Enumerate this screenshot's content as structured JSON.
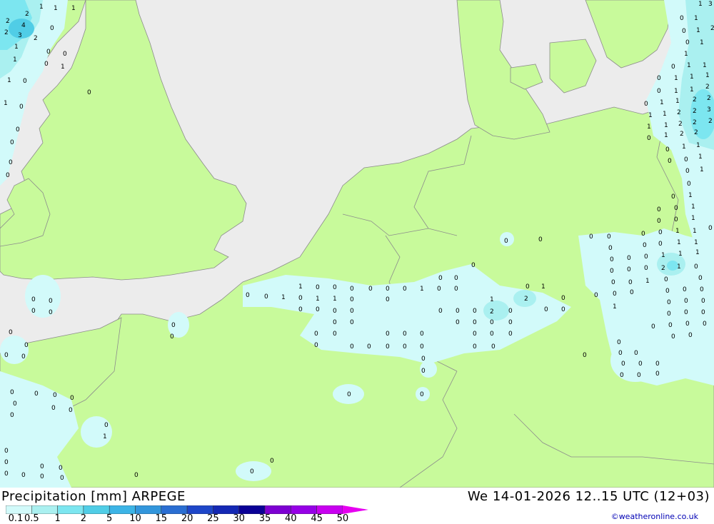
{
  "title": "Precipitation [mm] ARPEGE",
  "datetime": "We 14-01-2026 12..15 UTC (12+03)",
  "credit": "©weatheronline.co.uk",
  "legend": {
    "labels": [
      "0.1",
      "0.5",
      "1",
      "2",
      "5",
      "10",
      "15",
      "20",
      "25",
      "30",
      "35",
      "40",
      "45",
      "50"
    ],
    "colors": [
      "#d2fafa",
      "#aaf0f0",
      "#7ce6f0",
      "#50cde6",
      "#3cb4e6",
      "#3296dc",
      "#2a6ed2",
      "#1e46c8",
      "#1428b4",
      "#0a0096",
      "#7d00d2",
      "#9600e6",
      "#c800f0",
      "#e600f0",
      "#b400b4"
    ]
  },
  "colors": {
    "land": "#c8fa9b",
    "sea": "#ececec",
    "precip_light": "#d2fafa",
    "precip_mid": "#aaf0f0",
    "precip_high": "#7ce6f0",
    "precip_peak": "#50cde6",
    "border": "#8c8c8c"
  },
  "map_labels": {
    "v0": "0",
    "v1": "1",
    "v2": "2",
    "v3": "3",
    "v4": "4"
  }
}
